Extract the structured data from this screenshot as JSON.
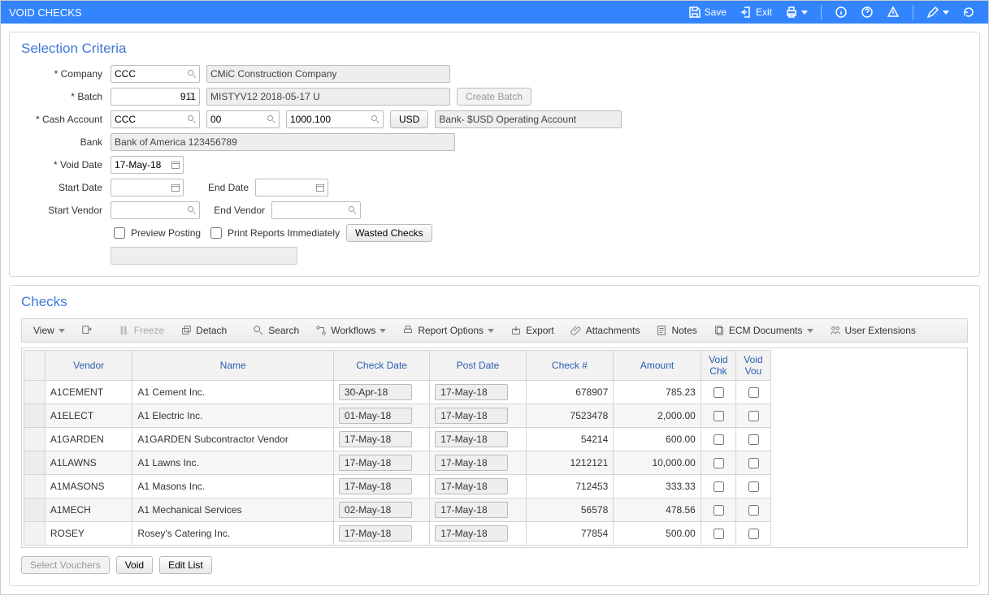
{
  "header": {
    "title": "VOID CHECKS",
    "save": "Save",
    "exit": "Exit"
  },
  "criteria": {
    "title": "Selection Criteria",
    "labels": {
      "company": "Company",
      "batch": "Batch",
      "cash_account": "Cash Account",
      "bank": "Bank",
      "void_date": "Void Date",
      "start_date": "Start Date",
      "end_date": "End Date",
      "start_vendor": "Start Vendor",
      "end_vendor": "End Vendor"
    },
    "company": {
      "code": "CCC",
      "name": "CMiC Construction Company"
    },
    "batch": {
      "number": "911",
      "desc": "MISTYV12 2018-05-17 U"
    },
    "create_batch": "Create Batch",
    "cash_account": {
      "comp": "CCC",
      "dept": "00",
      "acct": "1000.100",
      "currency": "USD",
      "name": "Bank- $USD Operating Account"
    },
    "bank": "Bank of America 123456789",
    "void_date": "17-May-18",
    "preview_posting": "Preview Posting",
    "print_reports": "Print Reports Immediately",
    "wasted_checks": "Wasted Checks"
  },
  "checks": {
    "title": "Checks",
    "toolbar": {
      "view": "View",
      "freeze": "Freeze",
      "detach": "Detach",
      "search": "Search",
      "workflows": "Workflows",
      "report_options": "Report Options",
      "export": "Export",
      "attachments": "Attachments",
      "notes": "Notes",
      "ecm_documents": "ECM Documents",
      "user_extensions": "User Extensions"
    },
    "columns": [
      "Vendor",
      "Name",
      "Check Date",
      "Post Date",
      "Check #",
      "Amount",
      "Void Chk",
      "Void Vou"
    ],
    "rows": [
      {
        "vendor": "A1CEMENT",
        "name": "A1 Cement Inc.",
        "check_date": "30-Apr-18",
        "post_date": "17-May-18",
        "check_no": "678907",
        "amount": "785.23"
      },
      {
        "vendor": "A1ELECT",
        "name": "A1 Electric Inc.",
        "check_date": "01-May-18",
        "post_date": "17-May-18",
        "check_no": "7523478",
        "amount": "2,000.00"
      },
      {
        "vendor": "A1GARDEN",
        "name": "A1GARDEN Subcontractor Vendor",
        "check_date": "17-May-18",
        "post_date": "17-May-18",
        "check_no": "54214",
        "amount": "600.00"
      },
      {
        "vendor": "A1LAWNS",
        "name": "A1 Lawns Inc.",
        "check_date": "17-May-18",
        "post_date": "17-May-18",
        "check_no": "1212121",
        "amount": "10,000.00"
      },
      {
        "vendor": "A1MASONS",
        "name": "A1 Masons Inc.",
        "check_date": "17-May-18",
        "post_date": "17-May-18",
        "check_no": "712453",
        "amount": "333.33"
      },
      {
        "vendor": "A1MECH",
        "name": "A1 Mechanical Services",
        "check_date": "02-May-18",
        "post_date": "17-May-18",
        "check_no": "56578",
        "amount": "478.56"
      },
      {
        "vendor": "ROSEY",
        "name": "Rosey's Catering Inc.",
        "check_date": "17-May-18",
        "post_date": "17-May-18",
        "check_no": "77854",
        "amount": "500.00"
      }
    ],
    "buttons": {
      "select_vouchers": "Select Vouchers",
      "void": "Void",
      "edit_list": "Edit List"
    }
  }
}
